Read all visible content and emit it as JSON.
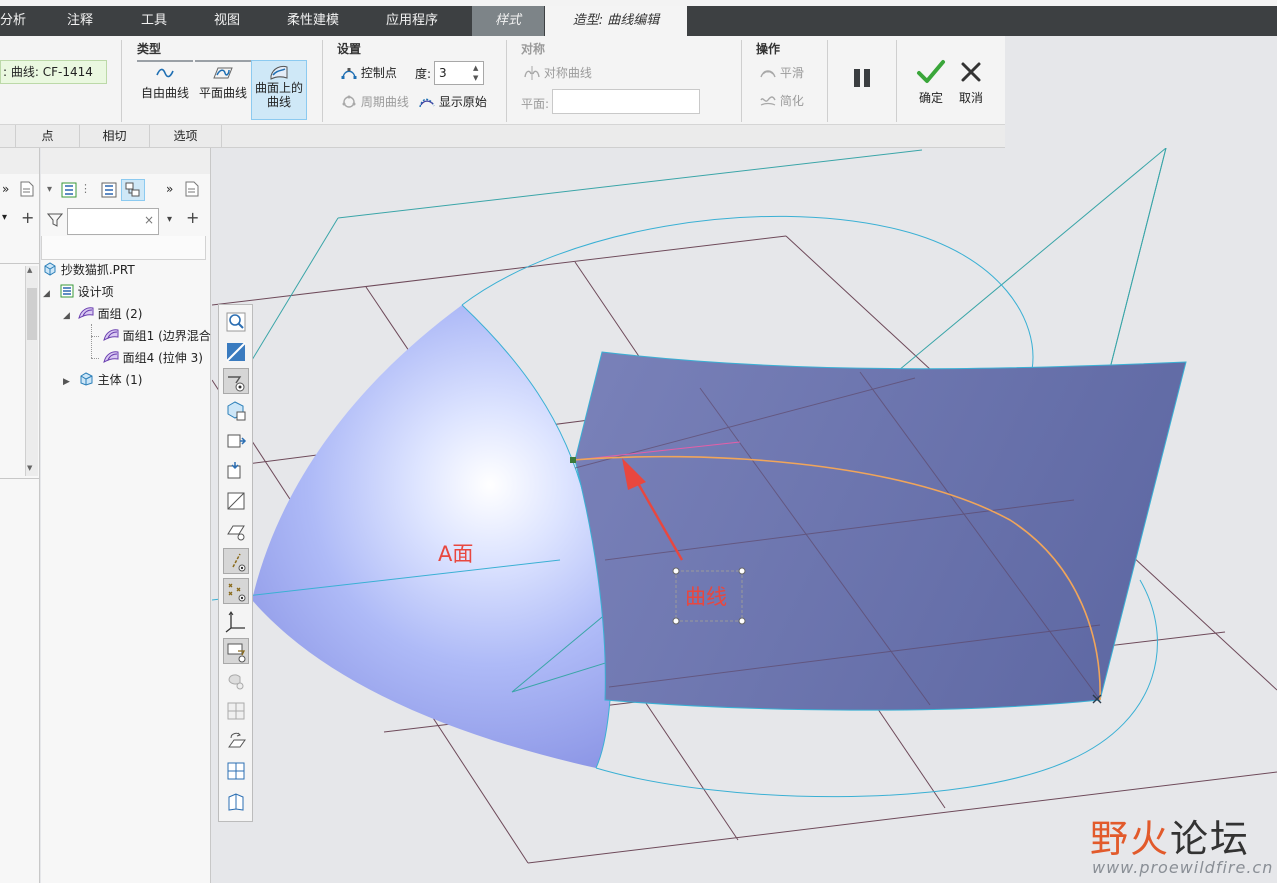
{
  "tabs": {
    "items": [
      "分析",
      "注释",
      "工具",
      "视图",
      "柔性建模",
      "应用程序"
    ],
    "style": "样式",
    "active": "造型: 曲线编辑"
  },
  "ribbon": {
    "reference_value": ": 曲线: CF-1414",
    "type_group": {
      "title": "类型",
      "free": "自由曲线",
      "planar": "平面曲线",
      "on_surface_line1": "曲面上的",
      "on_surface_line2": "曲线"
    },
    "settings_group": {
      "title": "设置",
      "control_points": "控制点",
      "degree_label": "度:",
      "degree_value": "3",
      "periodic": "周期曲线",
      "show_original": "显示原始"
    },
    "symmetry_group": {
      "title": "对称",
      "symmetric_curve": "对称曲线",
      "plane_label": "平面:"
    },
    "operation_group": {
      "title": "操作",
      "smooth": "平滑",
      "simplify": "简化"
    },
    "confirm": "确定",
    "cancel": "取消"
  },
  "subtabs": [
    "点",
    "相切",
    "选项"
  ],
  "tree": {
    "root": "抄数猫抓.PRT",
    "design_items": "设计项",
    "quilts": "面组 (2)",
    "quilt1": "面组1 (边界混合",
    "quilt4": "面组4 (拉伸 3)",
    "bodies": "主体 (1)"
  },
  "annotations": {
    "face_label": "A面",
    "curve_label": "曲线"
  },
  "watermark": {
    "logo_part1": "野",
    "logo_part2": "火",
    "logo_part3": "论坛",
    "url": "www.proewildfire.cn"
  },
  "colors": {
    "tab_bar": "#3d4042",
    "ribbon": "#f4f4f4",
    "surface_dark": "#6b74ad",
    "surface_light": "#aeb9f5",
    "curve_orange": "#f0a55a",
    "wire_cyan": "#3ab0d4",
    "annotation_red": "#e8473f",
    "confirm_green": "#3aa63a"
  }
}
